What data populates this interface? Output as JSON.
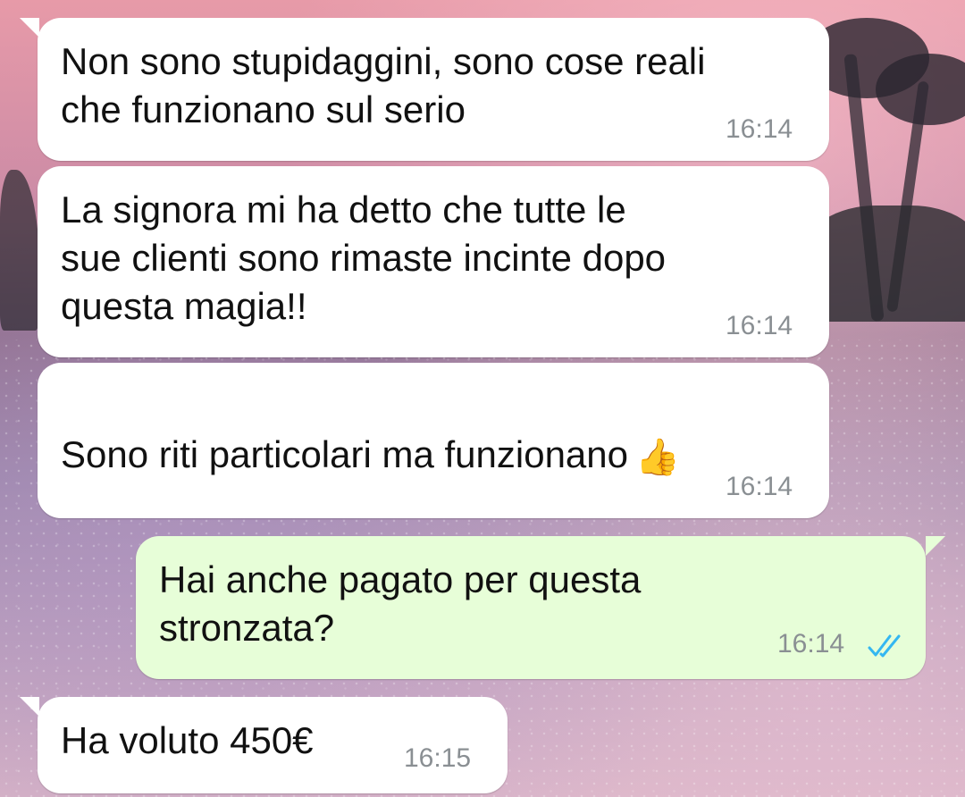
{
  "messages": [
    {
      "id": "msg1",
      "direction": "incoming",
      "text": "Non sono stupidaggini, sono cose reali\nche funzionano sul serio",
      "time": "16:14"
    },
    {
      "id": "msg2",
      "direction": "incoming",
      "text": "La signora mi ha detto che tutte le\nsue clienti sono rimaste incinte dopo\nquesta magia!!",
      "time": "16:14"
    },
    {
      "id": "msg3",
      "direction": "incoming",
      "text": "Sono riti particolari ma funzionano",
      "emoji": "👍",
      "emoji_name": "thumbs-up",
      "time": "16:14"
    },
    {
      "id": "msg4",
      "direction": "outgoing",
      "text": "Hai anche pagato per questa\nstronzata?",
      "time": "16:14",
      "read_status": "read",
      "tick_color": "#34b7f1"
    },
    {
      "id": "msg5",
      "direction": "incoming",
      "text": "Ha voluto 450€",
      "time": "16:15"
    }
  ],
  "colors": {
    "incoming_bubble": "#ffffff",
    "outgoing_bubble": "#e7fed8",
    "timestamp": "#8a8f93",
    "read_ticks": "#34b7f1"
  }
}
